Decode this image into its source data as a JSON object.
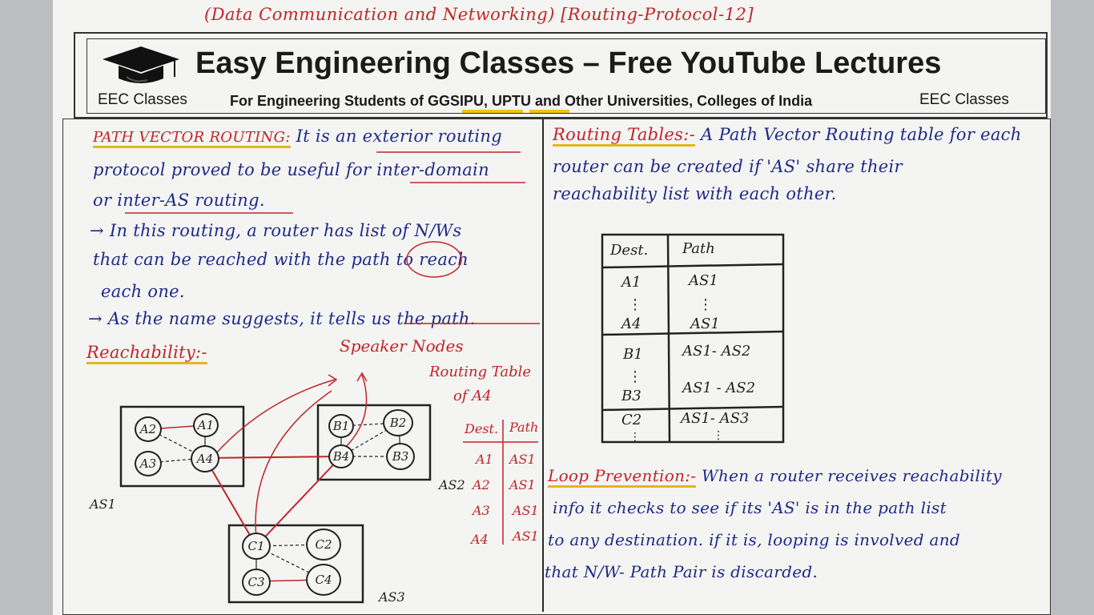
{
  "header": {
    "topic": "(Data Communication and Networking) [Routing-Protocol-12]",
    "brand_title": "Easy Engineering Classes – Free YouTube Lectures",
    "brand_left": "EEC Classes",
    "brand_right": "EEC Classes",
    "subtitle": "For Engineering Students of GGSIPU, UPTU and Other Universities, Colleges of India"
  },
  "left": {
    "path_vector": {
      "heading": "PATH VECTOR ROUTING:",
      "line1": "It is an exterior routing",
      "line2": "protocol proved to be useful for inter-domain",
      "line3": "or inter-AS routing."
    },
    "points": [
      "→ In this routing, a router has list of N/Ws",
      "that can be reached with the path to reach",
      "each one.",
      "→ As the name suggests, it tells us the path."
    ],
    "reachability_heading": "Reachability:-",
    "speaker_nodes": "Speaker Nodes",
    "routing_table_a4": {
      "title_line1": "Routing Table",
      "title_line2": "of A4",
      "headers": [
        "Dest.",
        "Path"
      ],
      "rows": [
        {
          "dest": "A1",
          "path": "AS1"
        },
        {
          "dest": "A2",
          "path": "AS1"
        },
        {
          "dest": "A3",
          "path": "AS1"
        },
        {
          "dest": "A4",
          "path": "AS1"
        }
      ]
    },
    "diagram": {
      "as_labels": [
        "AS1",
        "AS2",
        "AS3"
      ],
      "nodes": {
        "as1": [
          "A2",
          "A1",
          "A3",
          "A4"
        ],
        "as2": [
          "B1",
          "B2",
          "B4",
          "B3"
        ],
        "as3": [
          "C1",
          "C2",
          "C3",
          "C4"
        ]
      }
    }
  },
  "right": {
    "routing_tables": {
      "heading": "Routing Tables:-",
      "line1": "A Path Vector Routing table for each",
      "line2": "router can be created if 'AS' share their",
      "line3": "reachability list with each other."
    },
    "table": {
      "headers": [
        "Dest.",
        "Path"
      ],
      "groups": [
        {
          "dest_top": "A1",
          "dest_bottom": "A4",
          "path_top": "AS1",
          "path_bottom": "AS1"
        },
        {
          "dest_top": "B1",
          "dest_bottom": "B3",
          "path_top": "AS1- AS2",
          "path_bottom": "AS1 - AS2"
        },
        {
          "dest_top": "C2",
          "dest_bottom": "",
          "path_top": "AS1- AS3",
          "path_bottom": ""
        }
      ]
    },
    "loop_prevention": {
      "heading": "Loop Prevention:-",
      "line1": "When a router receives reachability",
      "line2": "info it checks to see if its 'AS' is in the path list",
      "line3": "to any destination. if it is, looping is involved and",
      "line4": "that N/W- Path Pair is discarded."
    }
  },
  "colors": {
    "ink_blue": "#1f2a8a",
    "ink_red": "#c0262a",
    "highlight_yellow": "#f1c40f",
    "paper": "#f4f4f2"
  }
}
